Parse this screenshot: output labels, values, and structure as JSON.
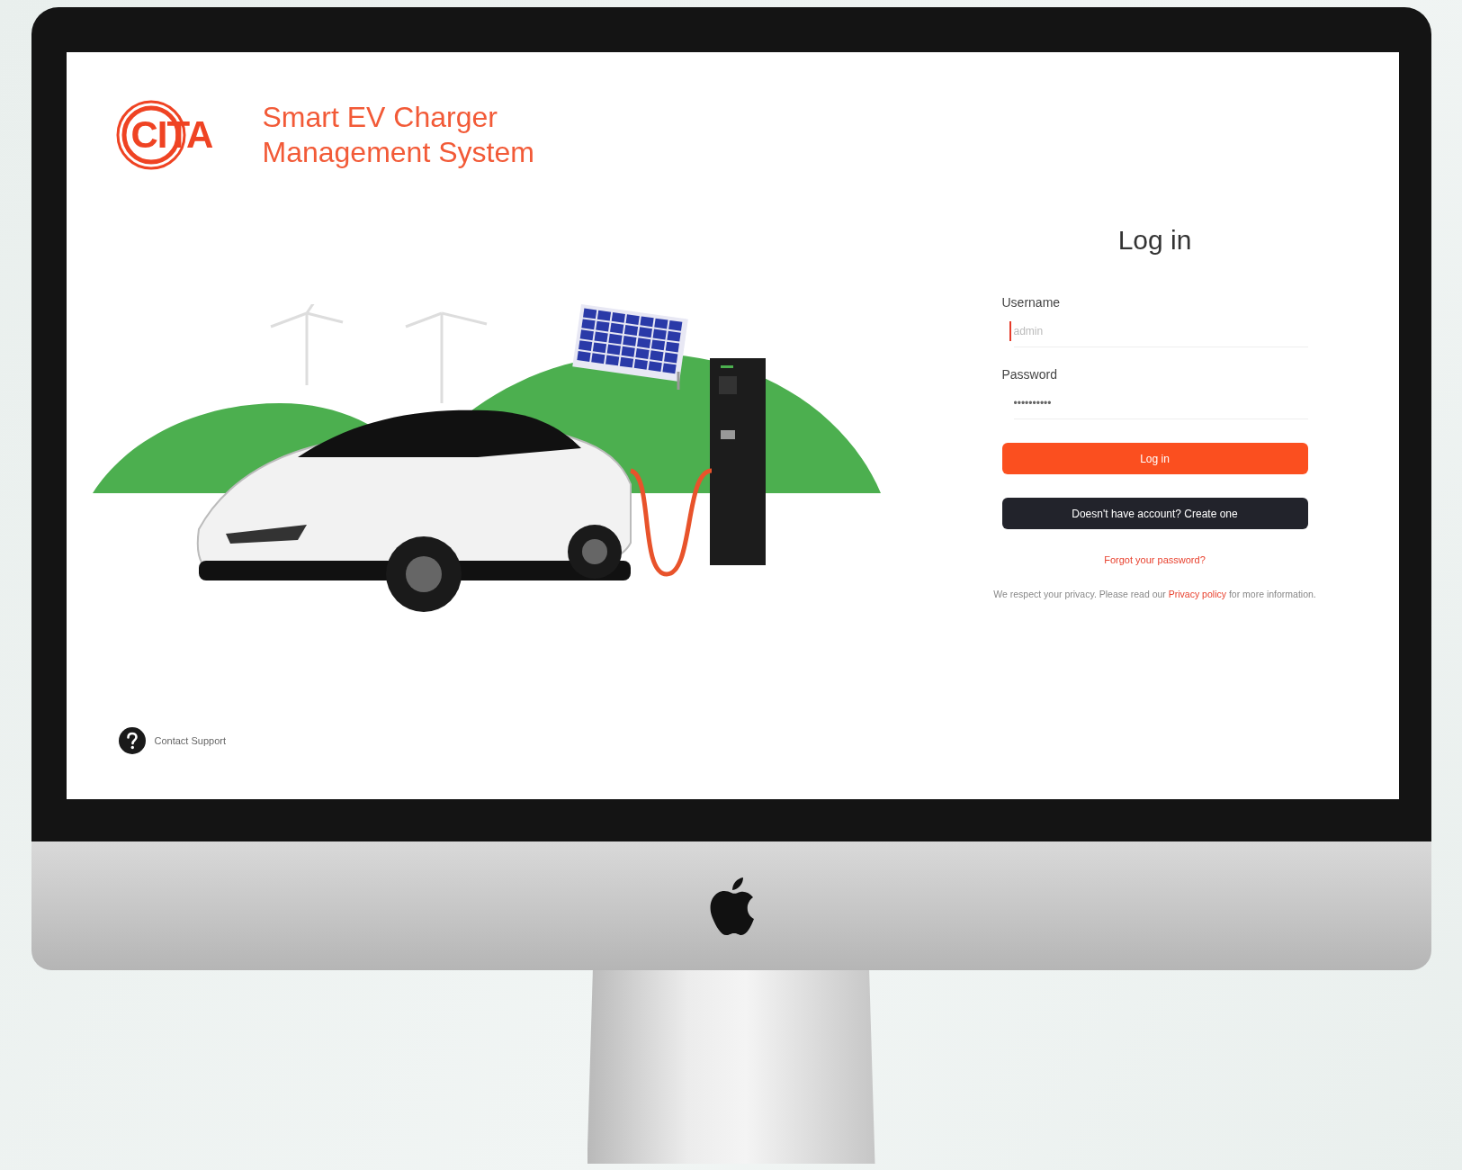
{
  "brand": {
    "logo": "CITA",
    "title_lines": [
      "Smart EV Charger",
      "Management System"
    ]
  },
  "login": {
    "title": "Log in",
    "fields": [
      {
        "label": "Username",
        "placeholder": "admin",
        "focused": true
      },
      {
        "label": "Password",
        "value": "••••••••••",
        "focused": false
      }
    ],
    "buttons": [
      {
        "label": "Log in",
        "kind": "primary"
      },
      {
        "label": "Doesn't have account? Create one",
        "kind": "dark"
      }
    ],
    "forgot_link": "Forgot your password?",
    "privacy": {
      "before": "We respect your privacy. Please read our ",
      "link": "Privacy policy",
      "after": " for more information."
    }
  },
  "support": {
    "label": "Contact Support"
  }
}
